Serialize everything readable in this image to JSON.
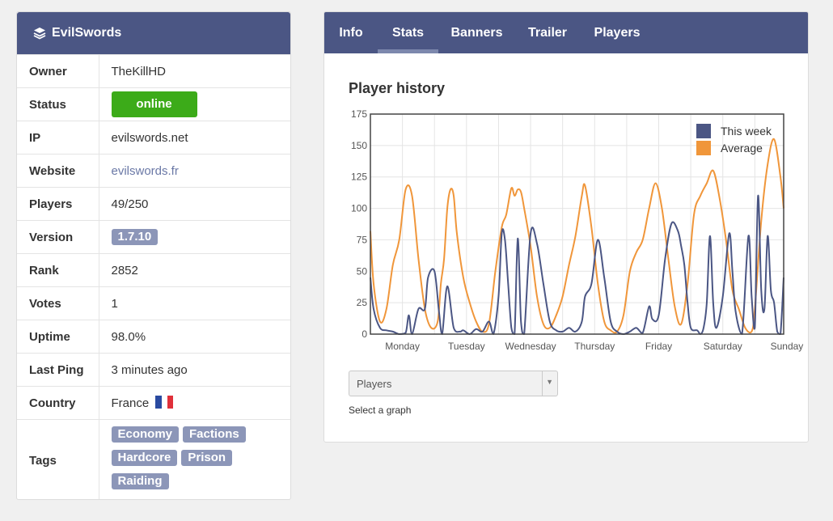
{
  "server": {
    "name": "EvilSwords",
    "logo_icon": "layers-icon"
  },
  "info": [
    {
      "key": "Owner",
      "value": "TheKillHD",
      "kind": "text"
    },
    {
      "key": "Status",
      "value": "online",
      "kind": "status"
    },
    {
      "key": "IP",
      "value": "evilswords.net",
      "kind": "text"
    },
    {
      "key": "Website",
      "value": "evilswords.fr",
      "kind": "link"
    },
    {
      "key": "Players",
      "value": "49/250",
      "kind": "text"
    },
    {
      "key": "Version",
      "value": "1.7.10",
      "kind": "badge"
    },
    {
      "key": "Rank",
      "value": "2852",
      "kind": "text"
    },
    {
      "key": "Votes",
      "value": "1",
      "kind": "text"
    },
    {
      "key": "Uptime",
      "value": "98.0%",
      "kind": "text"
    },
    {
      "key": "Last Ping",
      "value": "3 minutes ago",
      "kind": "text"
    },
    {
      "key": "Country",
      "value": "France",
      "kind": "flag"
    }
  ],
  "tags_label": "Tags",
  "tags": [
    "Economy",
    "Factions",
    "Hardcore",
    "Prison",
    "Raiding"
  ],
  "colors": {
    "header": "#4b5684",
    "online": "#3cab19",
    "badge": "#8c96b8",
    "this_week": "#4b5684",
    "average": "#f0963a"
  },
  "tabs": [
    {
      "label": "Info",
      "active": false
    },
    {
      "label": "Stats",
      "active": true
    },
    {
      "label": "Banners",
      "active": false
    },
    {
      "label": "Trailer",
      "active": false
    },
    {
      "label": "Players",
      "active": false
    }
  ],
  "panel_title": "Player history",
  "chart_data": {
    "type": "line",
    "categories": [
      "Monday",
      "Tuesday",
      "Wednesday",
      "Thursday",
      "Friday",
      "Saturday",
      "Sunday"
    ],
    "ylim": [
      0,
      175
    ],
    "yticks": [
      0,
      25,
      50,
      75,
      100,
      125,
      150,
      175
    ],
    "grid": true,
    "legend_position": "top-right",
    "series": [
      {
        "name": "This week",
        "color": "#4b5684",
        "x": [
          0.0,
          0.05,
          0.15,
          0.25,
          0.35,
          0.45,
          0.55,
          0.6,
          0.65,
          0.75,
          0.85,
          0.9,
          1.0,
          1.07,
          1.12,
          1.2,
          1.3,
          1.4,
          1.45,
          1.55,
          1.65,
          1.75,
          1.85,
          1.92,
          2.0,
          2.05,
          2.1,
          2.15,
          2.2,
          2.25,
          2.3,
          2.35,
          2.4,
          2.5,
          2.6,
          2.7,
          2.8,
          2.9,
          3.0,
          3.1,
          3.2,
          3.3,
          3.35,
          3.45,
          3.55,
          3.65,
          3.75,
          3.85,
          3.95,
          4.05,
          4.15,
          4.25,
          4.35,
          4.4,
          4.5,
          4.6,
          4.7,
          4.8,
          4.85,
          4.9,
          4.95,
          5.0,
          5.1,
          5.15,
          5.2,
          5.25,
          5.3,
          5.35,
          5.4,
          5.5,
          5.6,
          5.65,
          5.7,
          5.8,
          5.9,
          5.95,
          6.0,
          6.05,
          6.1,
          6.15,
          6.2,
          6.25,
          6.3,
          6.35,
          6.4,
          6.45
        ],
        "values": [
          45,
          20,
          5,
          3,
          2,
          0,
          1,
          15,
          0,
          20,
          20,
          45,
          50,
          18,
          0,
          38,
          5,
          2,
          3,
          0,
          4,
          2,
          10,
          0,
          30,
          80,
          75,
          40,
          5,
          0,
          76,
          10,
          0,
          80,
          72,
          40,
          10,
          3,
          2,
          5,
          2,
          10,
          30,
          40,
          75,
          45,
          10,
          2,
          0,
          2,
          5,
          1,
          22,
          12,
          15,
          60,
          88,
          82,
          70,
          55,
          25,
          5,
          3,
          0,
          5,
          25,
          78,
          25,
          5,
          30,
          80,
          50,
          18,
          0,
          78,
          30,
          5,
          110,
          35,
          20,
          78,
          35,
          25,
          2,
          0,
          45
        ]
      },
      {
        "name": "Average",
        "color": "#f0963a",
        "x": [
          0.0,
          0.05,
          0.15,
          0.25,
          0.35,
          0.45,
          0.55,
          0.65,
          0.75,
          0.85,
          0.95,
          1.05,
          1.1,
          1.15,
          1.2,
          1.25,
          1.3,
          1.35,
          1.45,
          1.55,
          1.65,
          1.75,
          1.85,
          1.95,
          2.05,
          2.12,
          2.2,
          2.25,
          2.3,
          2.35,
          2.4,
          2.5,
          2.6,
          2.7,
          2.8,
          2.9,
          3.0,
          3.1,
          3.2,
          3.3,
          3.35,
          3.45,
          3.55,
          3.65,
          3.75,
          3.85,
          3.95,
          4.05,
          4.15,
          4.25,
          4.35,
          4.45,
          4.55,
          4.65,
          4.75,
          4.85,
          4.95,
          5.05,
          5.15,
          5.25,
          5.35,
          5.45,
          5.55,
          5.65,
          5.75,
          5.85,
          5.95,
          6.0,
          6.1,
          6.2,
          6.3,
          6.4,
          6.45
        ],
        "values": [
          82,
          40,
          10,
          20,
          55,
          75,
          115,
          110,
          60,
          20,
          5,
          10,
          40,
          60,
          100,
          115,
          110,
          80,
          45,
          25,
          10,
          2,
          8,
          50,
          85,
          95,
          116,
          110,
          115,
          113,
          100,
          70,
          30,
          8,
          5,
          15,
          30,
          55,
          78,
          110,
          118,
          85,
          40,
          10,
          3,
          2,
          15,
          50,
          65,
          75,
          100,
          120,
          100,
          60,
          22,
          8,
          40,
          95,
          110,
          120,
          130,
          108,
          75,
          35,
          20,
          5,
          2,
          20,
          90,
          135,
          155,
          125,
          100
        ]
      }
    ]
  },
  "select": {
    "value": "Players",
    "hint": "Select a graph"
  }
}
